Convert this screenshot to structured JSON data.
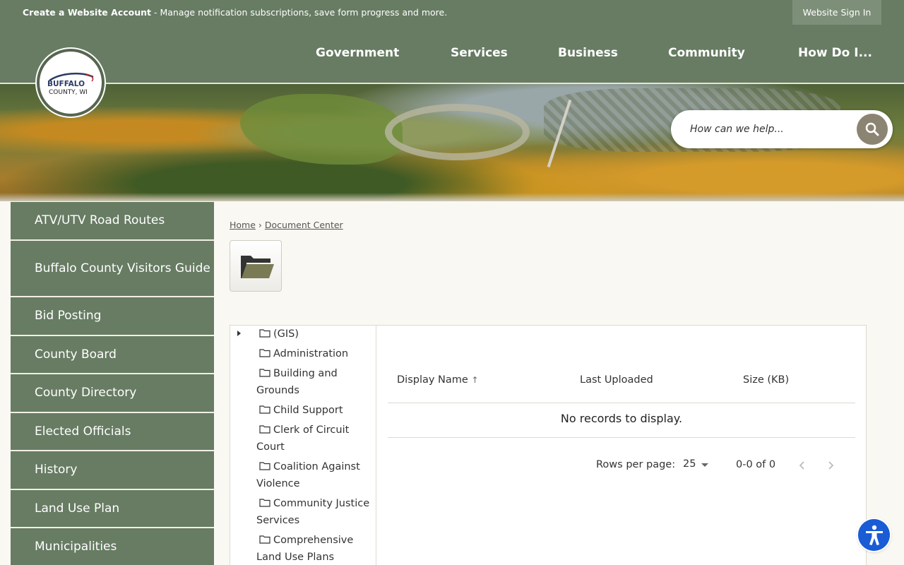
{
  "topbar": {
    "account_bold": "Create a Website Account",
    "account_rest": " - Manage notification subscriptions, save form progress and more.",
    "signin": "Website Sign In"
  },
  "logo": {
    "line1": "BUFFALO",
    "line2": "COUNTY, WI"
  },
  "nav": [
    "Government",
    "Services",
    "Business",
    "Community",
    "How Do I..."
  ],
  "search": {
    "placeholder": "How can we help...",
    "icon": "search-icon"
  },
  "sidebar": [
    "ATV/UTV Road Routes",
    "Buffalo County Visitors Guide",
    "Bid Posting",
    "County Board",
    "County Directory",
    "Elected Officials",
    "History",
    "Land Use Plan",
    "Municipalities"
  ],
  "breadcrumb": {
    "home": "Home",
    "sep": "›",
    "current": "Document Center"
  },
  "tree": [
    "(GIS)",
    "Administration",
    "Building and Grounds",
    "Child Support",
    "Clerk of Circuit Court",
    "Coalition Against Violence",
    "Community Justice Services",
    "Comprehensive Land Use Plans"
  ],
  "table": {
    "col_name": "Display Name",
    "sort_arrow": "↑",
    "col_uploaded": "Last Uploaded",
    "col_size": "Size (KB)",
    "empty": "No records to display.",
    "rows_per_page_label": "Rows per page:",
    "rows_per_page": "25",
    "range": "0-0 of 0"
  },
  "colors": {
    "brand_green": "#677c63",
    "accent_blue": "#1a5bd6",
    "background": "#faf8f2"
  }
}
